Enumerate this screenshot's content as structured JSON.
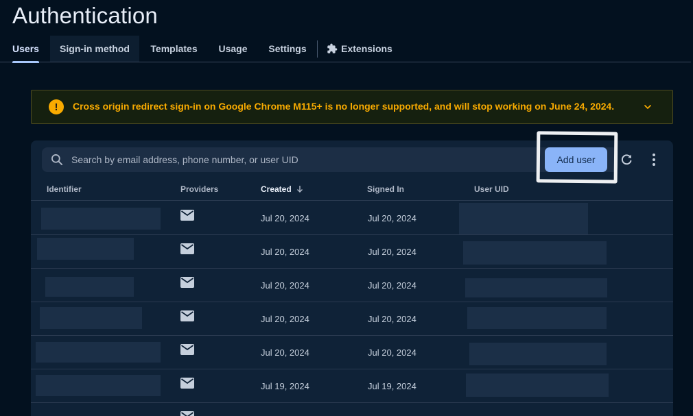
{
  "header": {
    "title": "Authentication"
  },
  "tabs": [
    {
      "label": "Users",
      "active": true
    },
    {
      "label": "Sign-in method",
      "active": false
    },
    {
      "label": "Templates",
      "active": false
    },
    {
      "label": "Usage",
      "active": false
    },
    {
      "label": "Settings",
      "active": false
    },
    {
      "label": "Extensions",
      "active": false,
      "icon": "extension-puzzle-icon"
    }
  ],
  "banner": {
    "icon": "warning-exclamation-icon",
    "text": "Cross origin redirect sign-in on Google Chrome M115+ is no longer supported, and will stop working on June 24, 2024.",
    "color": "#f9ab00"
  },
  "toolbar": {
    "search_placeholder": "Search by email address, phone number, or user UID",
    "add_user_label": "Add user",
    "accent": "#8ab4f8"
  },
  "table": {
    "columns": [
      "Identifier",
      "Providers",
      "Created",
      "Signed In",
      "User UID"
    ],
    "sorted_column": "Created",
    "sort_direction": "descending",
    "rows": [
      {
        "provider": "email-icon",
        "created": "Jul 20, 2024",
        "signed_in": "Jul 20, 2024"
      },
      {
        "provider": "email-icon",
        "created": "Jul 20, 2024",
        "signed_in": "Jul 20, 2024"
      },
      {
        "provider": "email-icon",
        "created": "Jul 20, 2024",
        "signed_in": "Jul 20, 2024"
      },
      {
        "provider": "email-icon",
        "created": "Jul 20, 2024",
        "signed_in": "Jul 20, 2024"
      },
      {
        "provider": "email-icon",
        "created": "Jul 20, 2024",
        "signed_in": "Jul 20, 2024"
      },
      {
        "provider": "email-icon",
        "created": "Jul 19, 2024",
        "signed_in": "Jul 19, 2024"
      },
      {
        "provider": "email-icon",
        "created": "",
        "signed_in": ""
      }
    ]
  }
}
